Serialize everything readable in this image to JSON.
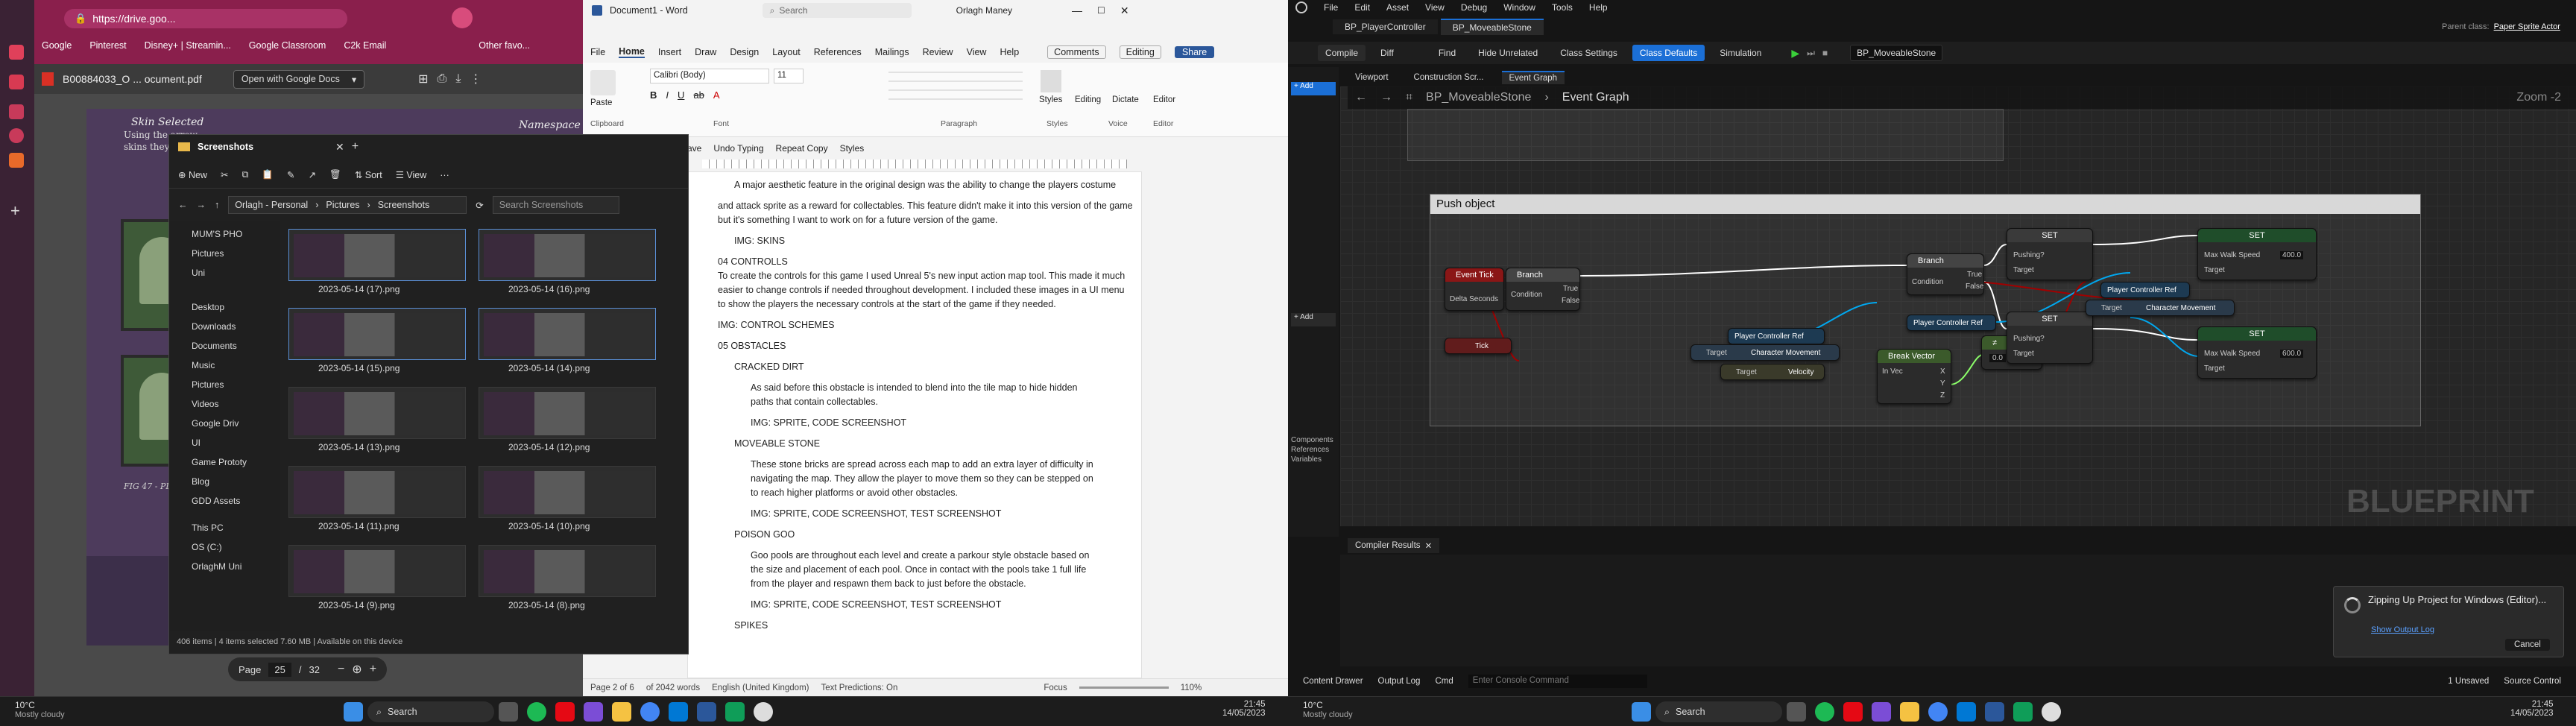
{
  "left_monitor": {
    "chrome": {
      "url": "https://drive.goo...",
      "bookmarks": [
        "Google",
        "Pinterest",
        "Disney+ | Streamin...",
        "Google Classroom",
        "C2k Email",
        "Other favo..."
      ],
      "pdf_tab_title": "B00884033_O ... ocument.pdf",
      "open_with_label": "Open with Google Docs",
      "page_label": "Page",
      "page_current": "25",
      "page_sep": "/",
      "page_total": "32",
      "pdf_heading_left": "Skin Selected",
      "pdf_text_left1": "Using the arrow",
      "pdf_text_left2": "skins they've un",
      "pdf_heading_right": "Namespace",
      "pdf_caption": "FIG 47 - PLAYER OPTI"
    },
    "word": {
      "title": "Document1 - Word",
      "search_placeholder": "Search",
      "user": "Orlagh Maney",
      "menu": [
        "File",
        "Home",
        "Insert",
        "Draw",
        "Design",
        "Layout",
        "References",
        "Mailings",
        "Review",
        "View",
        "Help"
      ],
      "comments_label": "Comments",
      "editing_label": "Editing",
      "share_label": "Share",
      "font_name": "Calibri (Body)",
      "font_size": "11",
      "groups": [
        "Clipboard",
        "Font",
        "Paragraph",
        "Styles",
        "Voice",
        "Editor"
      ],
      "ribbon_buttons": [
        "Paste",
        "Styles",
        "Editing",
        "Dictate",
        "Editor"
      ],
      "quick": [
        "ave",
        "Undo Typing",
        "Repeat Copy",
        "Styles"
      ],
      "body": [
        {
          "indent": 1,
          "text": "A major aesthetic feature in the original design was the ability to change the players costume"
        },
        {
          "indent": 0,
          "text": "and attack sprite as a reward for collectables. This feature didn't make it into this version of the game"
        },
        {
          "indent": 0,
          "text": "but it's something I want to work on for a future version of the game."
        },
        {
          "indent": 1,
          "text": "IMG: SKINS"
        },
        {
          "indent": 0,
          "text": "04 CONTROLLS"
        },
        {
          "indent": 0,
          "text": "To create the controls for this game I used Unreal 5's new input action map tool. This made it much"
        },
        {
          "indent": 0,
          "text": "easier to change controls if needed throughout development. I included these images in a UI menu"
        },
        {
          "indent": 0,
          "text": "to show the players the necessary controls at the start of the game if they needed."
        },
        {
          "indent": 0,
          "text": "IMG: CONTROL SCHEMES"
        },
        {
          "indent": 0,
          "text": "05 OBSTACLES"
        },
        {
          "indent": 1,
          "text": "CRACKED DIRT"
        },
        {
          "indent": 2,
          "text": "As said before this obstacle is intended to blend into the tile map to hide hidden"
        },
        {
          "indent": 2,
          "text": "paths that contain collectables."
        },
        {
          "indent": 2,
          "text": "IMG: SPRITE, CODE SCREENSHOT"
        },
        {
          "indent": 1,
          "text": "MOVEABLE STONE"
        },
        {
          "indent": 2,
          "text": "These stone bricks are spread across each map to add an extra layer of difficulty in"
        },
        {
          "indent": 2,
          "text": "navigating the map. They allow the player to move them so they can be stepped on"
        },
        {
          "indent": 2,
          "text": "to reach higher platforms or avoid other obstacles."
        },
        {
          "indent": 2,
          "text": "IMG: SPRITE, CODE SCREENSHOT, TEST SCREENSHOT"
        },
        {
          "indent": 1,
          "text": "POISON GOO"
        },
        {
          "indent": 2,
          "text": "Goo pools are throughout each level and create a parkour style obstacle based on"
        },
        {
          "indent": 2,
          "text": "the size and placement of each pool. Once in contact with the pools take 1 full life"
        },
        {
          "indent": 2,
          "text": "from the player and respawn them back to just before the obstacle."
        },
        {
          "indent": 2,
          "text": "IMG: SPRITE, CODE SCREENSHOT, TEST SCREENSHOT"
        },
        {
          "indent": 1,
          "text": "SPIKES"
        }
      ],
      "status": {
        "page": "Page 2 of 6",
        "words": "of 2042 words",
        "lang": "English (United Kingdom)",
        "predictions": "Text Predictions: On",
        "focus": "Focus",
        "zoom": "110%"
      }
    },
    "explorer": {
      "title": "Screenshots",
      "new_label": "New",
      "sort_label": "Sort",
      "view_label": "View",
      "breadcrumb": [
        "Orlagh - Personal",
        "Pictures",
        "Screenshots"
      ],
      "search_placeholder": "Search Screenshots",
      "nav": [
        "MUM'S PHO",
        "Pictures",
        "Uni",
        "Desktop",
        "Downloads",
        "Documents",
        "Music",
        "Pictures",
        "Videos",
        "Google Driv",
        "UI",
        "Game Prototy",
        "Blog",
        "GDD Assets",
        "This PC",
        "OS (C:)",
        "OrlaghM Uni"
      ],
      "files": [
        "2023-05-14 (17).png",
        "2023-05-14 (16).png",
        "2023-05-14 (15).png",
        "2023-05-14 (14).png",
        "2023-05-14 (13).png",
        "2023-05-14 (12).png",
        "2023-05-14 (11).png",
        "2023-05-14 (10).png",
        "2023-05-14 (9).png",
        "2023-05-14 (8).png"
      ],
      "status": "406 items  |  4 items selected  7.60 MB  |  Available on this device"
    },
    "taskbar": {
      "weather_temp": "10°C",
      "weather_desc": "Mostly cloudy",
      "search_label": "Search",
      "time": "21:45",
      "date": "14/05/2023"
    }
  },
  "right_monitor": {
    "menu": [
      "File",
      "Edit",
      "Asset",
      "View",
      "Debug",
      "Window",
      "Tools",
      "Help"
    ],
    "parent_class_label": "Parent class:",
    "parent_class_value": "Paper Sprite Actor",
    "tabs": [
      "BP_PlayerController",
      "BP_MoveableStone"
    ],
    "toolbar": [
      "Compile",
      "Diff",
      "Find",
      "Hide Unrelated",
      "Class Settings",
      "Class Defaults",
      "Simulation"
    ],
    "debug_target": "BP_MoveableStone",
    "panel_tabs": [
      "Viewport",
      "Construction Scr...",
      "Event Graph"
    ],
    "breadcrumb": [
      "BP_MoveableStone",
      "Event Graph"
    ],
    "zoom": "Zoom -2",
    "comment_title": "Push object",
    "nodes": {
      "event_tick": "Event Tick",
      "delta": "Delta Seconds",
      "tick": "Tick",
      "branch": "Branch",
      "branch2": "Branch",
      "set1": "SET",
      "set2": "SET",
      "set3": "SET",
      "set4": "SET",
      "condition": "Condition",
      "true_lbl": "True",
      "false_lbl": "False",
      "pc_ref": "Player Controller Ref",
      "char_move": "Character Movement",
      "velocity": "Velocity",
      "target": "Target",
      "break_vector": "Break Vector",
      "in_vec": "In Vec",
      "pushing": "Pushing?",
      "max_walk": "Max Walk Speed",
      "walk_val_1": "400.0",
      "walk_val_2": "600.0",
      "compare_val": "0.0"
    },
    "watermark": "BLUEPRINT",
    "compiler_tab": "Compiler Results",
    "bottom_bar": [
      "Content Drawer",
      "Output Log",
      "Cmd"
    ],
    "console_placeholder": "Enter Console Command",
    "unsaved": "1 Unsaved",
    "source_control": "Source Control",
    "toast_title": "Zipping Up Project for Windows (Editor)...",
    "toast_link": "Show Output Log",
    "toast_cancel": "Cancel",
    "left_panel": [
      "Components",
      "References",
      "Variables"
    ],
    "taskbar": {
      "weather_temp": "10°C",
      "weather_desc": "Mostly cloudy",
      "search_label": "Search",
      "time": "21:45",
      "date": "14/05/2023"
    }
  },
  "colors": {
    "chrome_accent": "#8a1f4c",
    "word_accent": "#2b579a",
    "ue_blue": "#1b6fd6"
  }
}
